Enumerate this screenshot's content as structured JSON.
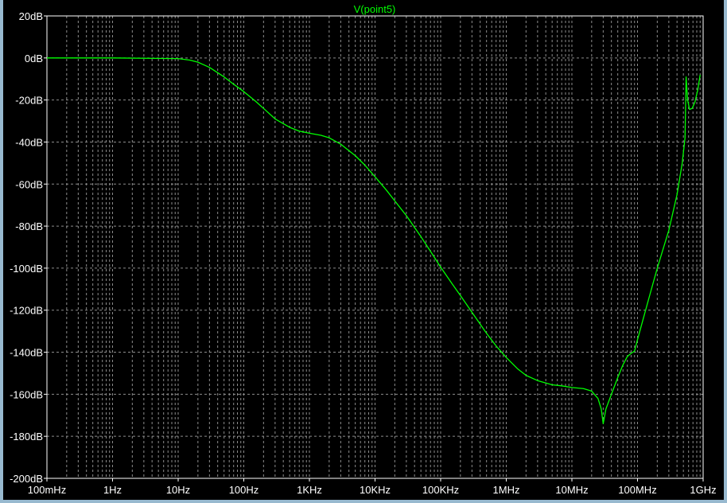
{
  "chart_data": {
    "type": "line",
    "title": "",
    "xlabel": "",
    "ylabel": "",
    "x_scale": "log",
    "xlim": [
      0.1,
      1000000000
    ],
    "ylim": [
      -200,
      20
    ],
    "grid": true,
    "legend": "top-center",
    "background_color": "#000000",
    "grid_color": "#8c8c8c",
    "text_color": "#ffffff",
    "x_ticks": [
      {
        "value": 0.1,
        "label": "100mHz"
      },
      {
        "value": 1,
        "label": "1Hz"
      },
      {
        "value": 10,
        "label": "10Hz"
      },
      {
        "value": 100,
        "label": "100Hz"
      },
      {
        "value": 1000,
        "label": "1KHz"
      },
      {
        "value": 10000,
        "label": "10KHz"
      },
      {
        "value": 100000,
        "label": "100KHz"
      },
      {
        "value": 1000000,
        "label": "1MHz"
      },
      {
        "value": 10000000,
        "label": "10MHz"
      },
      {
        "value": 100000000,
        "label": "100MHz"
      },
      {
        "value": 1000000000,
        "label": "1GHz"
      }
    ],
    "y_ticks": [
      {
        "value": 20,
        "label": "20dB"
      },
      {
        "value": 0,
        "label": "0dB"
      },
      {
        "value": -20,
        "label": "-20dB"
      },
      {
        "value": -40,
        "label": "-40dB"
      },
      {
        "value": -60,
        "label": "-60dB"
      },
      {
        "value": -80,
        "label": "-80dB"
      },
      {
        "value": -100,
        "label": "-100dB"
      },
      {
        "value": -120,
        "label": "-120dB"
      },
      {
        "value": -140,
        "label": "-140dB"
      },
      {
        "value": -160,
        "label": "-160dB"
      },
      {
        "value": -180,
        "label": "-180dB"
      },
      {
        "value": -200,
        "label": "-200dB"
      }
    ],
    "series": [
      {
        "name": "V(point5)",
        "color": "#00ff00",
        "x": [
          0.1,
          1,
          10,
          15,
          20,
          30,
          50,
          70,
          100,
          150,
          200,
          300,
          500,
          700,
          1000,
          1500,
          2000,
          3000,
          5000,
          7000,
          10000,
          15000,
          20000,
          30000,
          50000,
          70000,
          100000,
          150000,
          200000,
          300000,
          500000,
          700000,
          1000000,
          1500000,
          2000000,
          3000000,
          5000000,
          7000000,
          10000000,
          15000000,
          20000000,
          25000000,
          28000000,
          30000000,
          33000000,
          40000000,
          50000000,
          60000000,
          70000000,
          80000000,
          90000000,
          100000000,
          150000000,
          200000000,
          300000000,
          400000000,
          480000000,
          530000000,
          550000000,
          580000000,
          620000000,
          680000000,
          750000000,
          830000000,
          900000000
        ],
        "values": [
          0,
          0,
          -0.3,
          -1,
          -2,
          -4.5,
          -9,
          -12.5,
          -16,
          -20.5,
          -24,
          -29,
          -33,
          -34.8,
          -35.8,
          -36.8,
          -38,
          -41,
          -46.5,
          -51,
          -56.5,
          -63,
          -68,
          -75,
          -85,
          -92,
          -99.5,
          -107.5,
          -113,
          -121,
          -131,
          -137,
          -142.5,
          -148,
          -151,
          -153.5,
          -155.5,
          -156,
          -156.8,
          -157.3,
          -158.5,
          -162,
          -167,
          -174,
          -167,
          -160,
          -152,
          -146,
          -142,
          -140.5,
          -139.5,
          -134,
          -114,
          -100,
          -82,
          -65,
          -50,
          -38,
          -9,
          -20,
          -24.5,
          -24,
          -21,
          -15,
          -8
        ]
      }
    ]
  }
}
